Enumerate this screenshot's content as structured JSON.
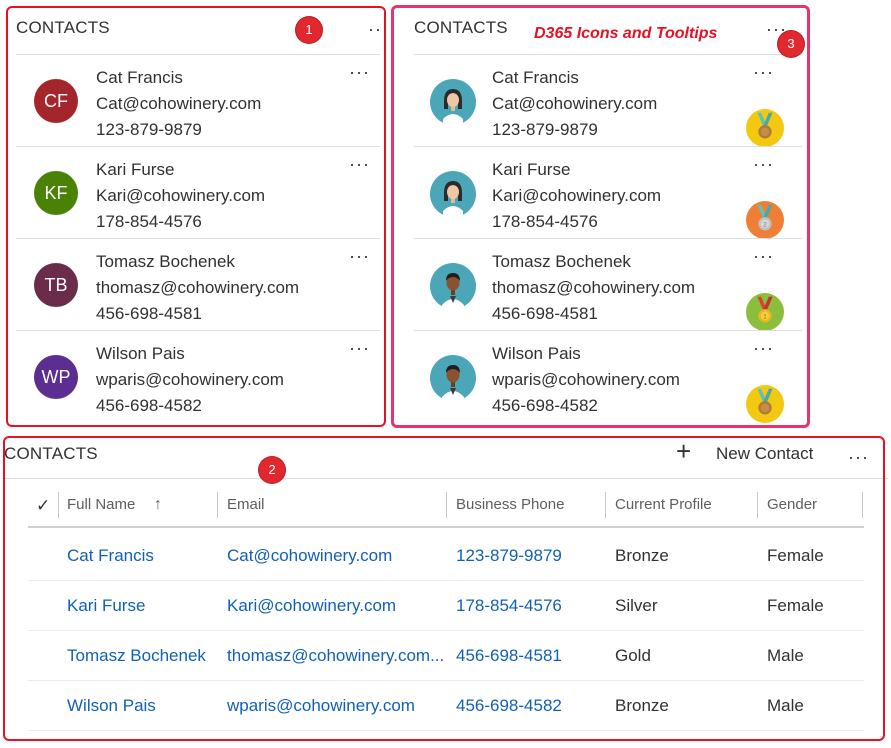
{
  "panel1": {
    "title": "CONTACTS",
    "more": "···",
    "badge": "1",
    "contacts": [
      {
        "initials": "CF",
        "name": "Cat Francis",
        "email": "Cat@cohowinery.com",
        "phone": "123-879-9879",
        "color": "#a4262c"
      },
      {
        "initials": "KF",
        "name": "Kari Furse",
        "email": "Kari@cohowinery.com",
        "phone": "178-854-4576",
        "color": "#498205"
      },
      {
        "initials": "TB",
        "name": "Tomasz Bochenek",
        "email": "thomasz@cohowinery.com",
        "phone": "456-698-4581",
        "color": "#6b2c4a"
      },
      {
        "initials": "WP",
        "name": "Wilson Pais",
        "email": "wparis@cohowinery.com",
        "phone": "456-698-4582",
        "color": "#5c2e91"
      }
    ]
  },
  "panel3": {
    "title": "CONTACTS",
    "more": "···",
    "badge": "3",
    "annotation": "D365 Icons and Tooltips",
    "contacts": [
      {
        "name": "Cat Francis",
        "email": "Cat@cohowinery.com",
        "phone": "123-879-9879",
        "avatar": "female-avatar-icon",
        "medal": "bronze-medal-icon",
        "medal_color": "#f2c811",
        "medal_ribbon": "#5ec2b8",
        "medal_label": ""
      },
      {
        "name": "Kari Furse",
        "email": "Kari@cohowinery.com",
        "phone": "178-854-4576",
        "avatar": "female-avatar-icon",
        "medal": "silver-medal-icon",
        "medal_color": "#ef7f36",
        "medal_ribbon": "#5ec2b8",
        "medal_label": "2"
      },
      {
        "name": "Tomasz Bochenek",
        "email": "thomasz@cohowinery.com",
        "phone": "456-698-4581",
        "avatar": "male-avatar-icon",
        "medal": "gold-medal-icon",
        "medal_color": "#8cbd3c",
        "medal_ribbon": "#d9403a",
        "medal_label": "1"
      },
      {
        "name": "Wilson Pais",
        "email": "wparis@cohowinery.com",
        "phone": "456-698-4582",
        "avatar": "male-avatar-icon",
        "medal": "bronze-medal-icon",
        "medal_color": "#f2c811",
        "medal_ribbon": "#5ec2b8",
        "medal_label": ""
      }
    ]
  },
  "panel2": {
    "title": "CONTACTS",
    "badge": "2",
    "new_contact": "New Contact",
    "new_contact_icon": "+",
    "more": "···",
    "check": "✓",
    "sort_icon": "↑",
    "columns": [
      "Full Name",
      "Email",
      "Business Phone",
      "Current Profile",
      "Gender"
    ],
    "rows": [
      {
        "name": "Cat Francis",
        "email": "Cat@cohowinery.com",
        "phone": "123-879-9879",
        "profile": "Bronze",
        "gender": "Female"
      },
      {
        "name": "Kari Furse",
        "email": "Kari@cohowinery.com",
        "phone": "178-854-4576",
        "profile": "Silver",
        "gender": "Female"
      },
      {
        "name": "Tomasz Bochenek",
        "email": "thomasz@cohowinery.com...",
        "phone": "456-698-4581",
        "profile": "Gold",
        "gender": "Male"
      },
      {
        "name": "Wilson Pais",
        "email": "wparis@cohowinery.com",
        "phone": "456-698-4582",
        "profile": "Bronze",
        "gender": "Male"
      }
    ]
  },
  "colors": {
    "annotation_red": "#e81123",
    "highlight_pink": "#e8346a",
    "link_blue": "#1160b7"
  }
}
